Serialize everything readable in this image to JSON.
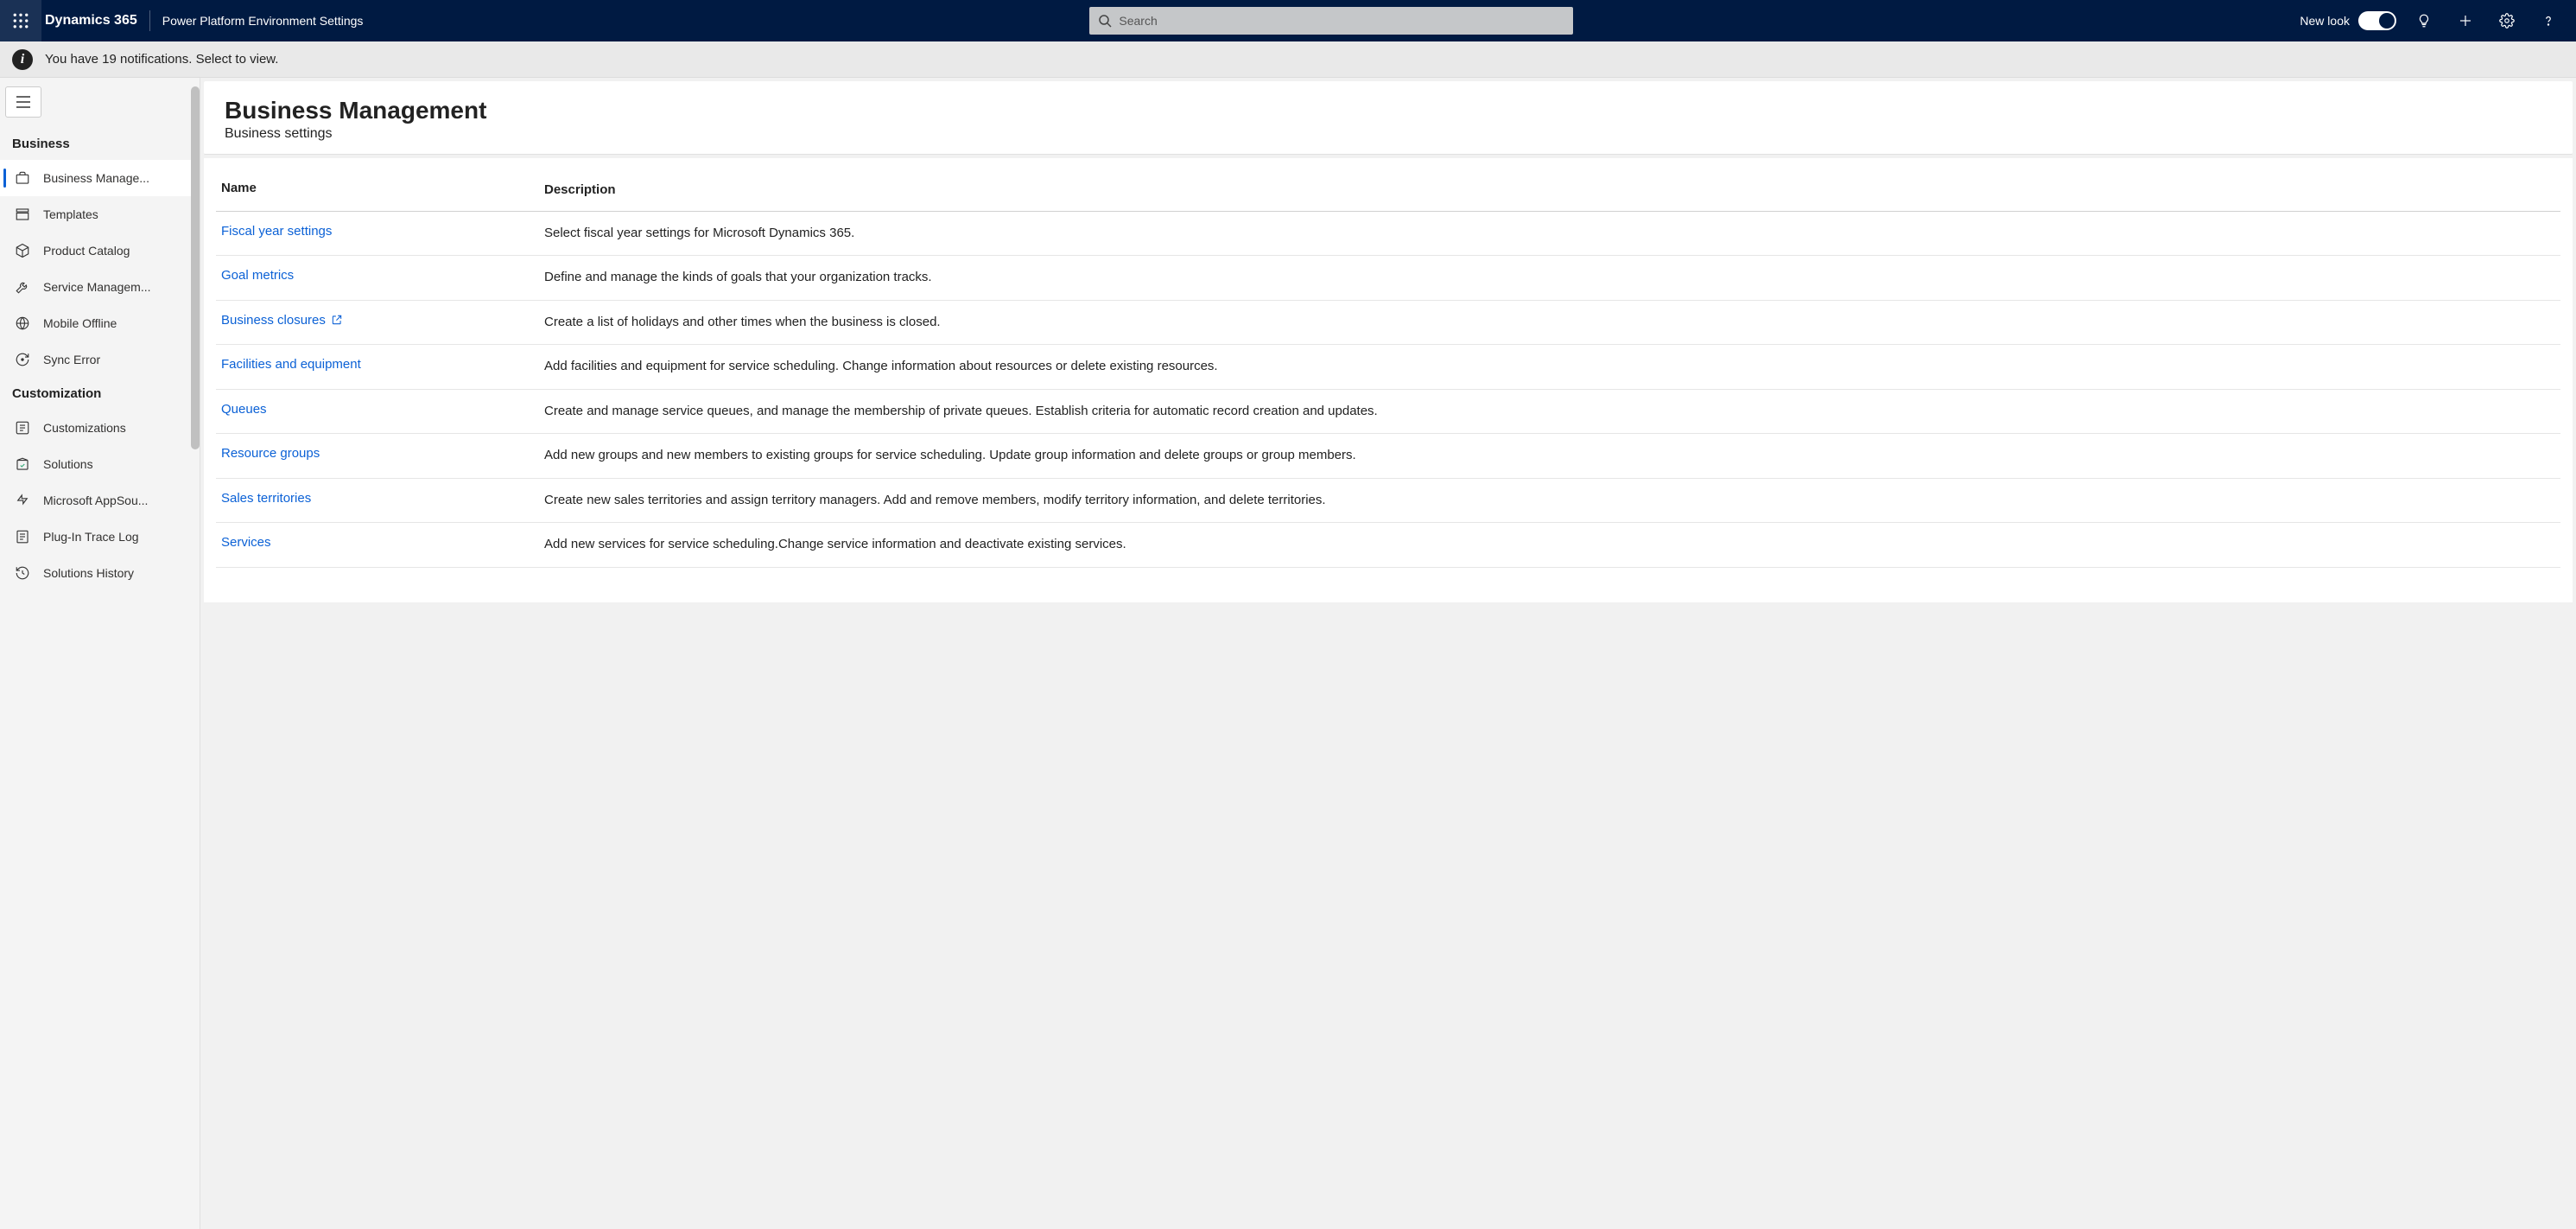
{
  "header": {
    "brand": "Dynamics 365",
    "subtitle": "Power Platform Environment Settings",
    "search_placeholder": "Search",
    "new_look_label": "New look"
  },
  "notification": {
    "text": "You have 19 notifications. Select to view."
  },
  "sidebar": {
    "group1_label": "Business",
    "items1": [
      {
        "label": "Business Manage...",
        "active": true
      },
      {
        "label": "Templates"
      },
      {
        "label": "Product Catalog"
      },
      {
        "label": "Service Managem..."
      },
      {
        "label": "Mobile Offline"
      },
      {
        "label": "Sync Error"
      }
    ],
    "group2_label": "Customization",
    "items2": [
      {
        "label": "Customizations"
      },
      {
        "label": "Solutions"
      },
      {
        "label": "Microsoft AppSou..."
      },
      {
        "label": "Plug-In Trace Log"
      },
      {
        "label": "Solutions History"
      }
    ]
  },
  "page": {
    "title": "Business Management",
    "subtitle": "Business settings",
    "table": {
      "col_name": "Name",
      "col_desc": "Description"
    },
    "rows": [
      {
        "name": "Fiscal year settings",
        "ext": false,
        "desc": "Select fiscal year settings for Microsoft Dynamics 365."
      },
      {
        "name": "Goal metrics",
        "ext": false,
        "desc": "Define and manage the kinds of goals that your organization tracks."
      },
      {
        "name": "Business closures",
        "ext": true,
        "desc": "Create a list of holidays and other times when the business is closed."
      },
      {
        "name": "Facilities and equipment",
        "ext": false,
        "desc": "Add facilities and equipment for service scheduling. Change information about resources or delete existing resources."
      },
      {
        "name": "Queues",
        "ext": false,
        "desc": "Create and manage service queues, and manage the membership of private queues. Establish criteria for automatic record creation and updates."
      },
      {
        "name": "Resource groups",
        "ext": false,
        "desc": "Add new groups and new members to existing groups for service scheduling. Update group information and delete groups or group members."
      },
      {
        "name": "Sales territories",
        "ext": false,
        "desc": "Create new sales territories and assign territory managers. Add and remove members, modify territory information, and delete territories."
      },
      {
        "name": "Services",
        "ext": false,
        "desc": "Add new services for service scheduling.Change service information and deactivate existing services."
      }
    ]
  }
}
